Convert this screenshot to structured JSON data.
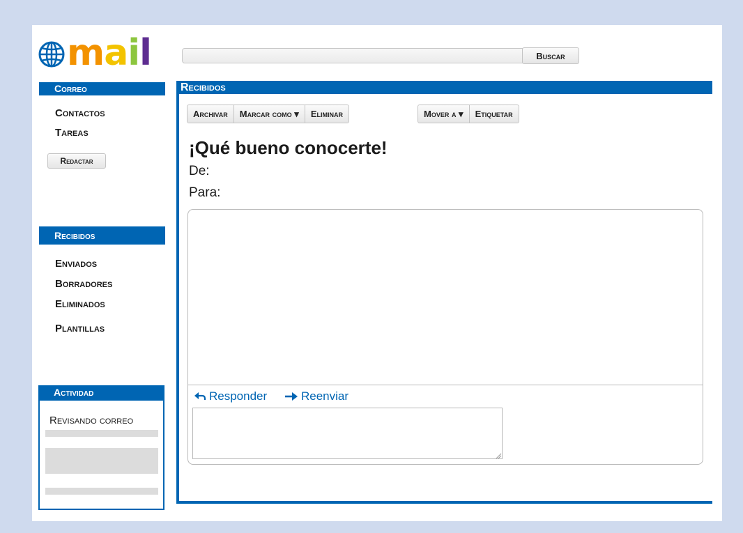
{
  "logo": {
    "text": "mail",
    "letter_colors": [
      "#f39200",
      "#f3c300",
      "#8dc63f",
      "#5e2d91"
    ]
  },
  "search": {
    "value": "",
    "button_label": "Buscar"
  },
  "sidebar": {
    "correo": "Correo",
    "contactos": "Contactos",
    "tareas": "Tareas",
    "compose_label": "Redactar",
    "recibidos": "Recibidos",
    "enviados": "Enviados",
    "borradores": "Borradores",
    "eliminados": "Eliminados",
    "plantillas": "Plantillas",
    "activity_title": "Actividad",
    "activity_text": "Revisando correo"
  },
  "main": {
    "title": "Recibidos",
    "toolbar_group1": [
      "Archivar",
      "Marcar como ▾",
      "Eliminar"
    ],
    "toolbar_group2": [
      "Mover a ▾",
      "Etiquetar"
    ],
    "subject": "¡Qué bueno conocerte!",
    "from_label": "De:",
    "to_label": "Para:",
    "reply_label": "Responder",
    "forward_label": "Reenviar",
    "reply_value": ""
  },
  "colors": {
    "accent": "#0065b3",
    "outer_background": "#cfdaee"
  }
}
